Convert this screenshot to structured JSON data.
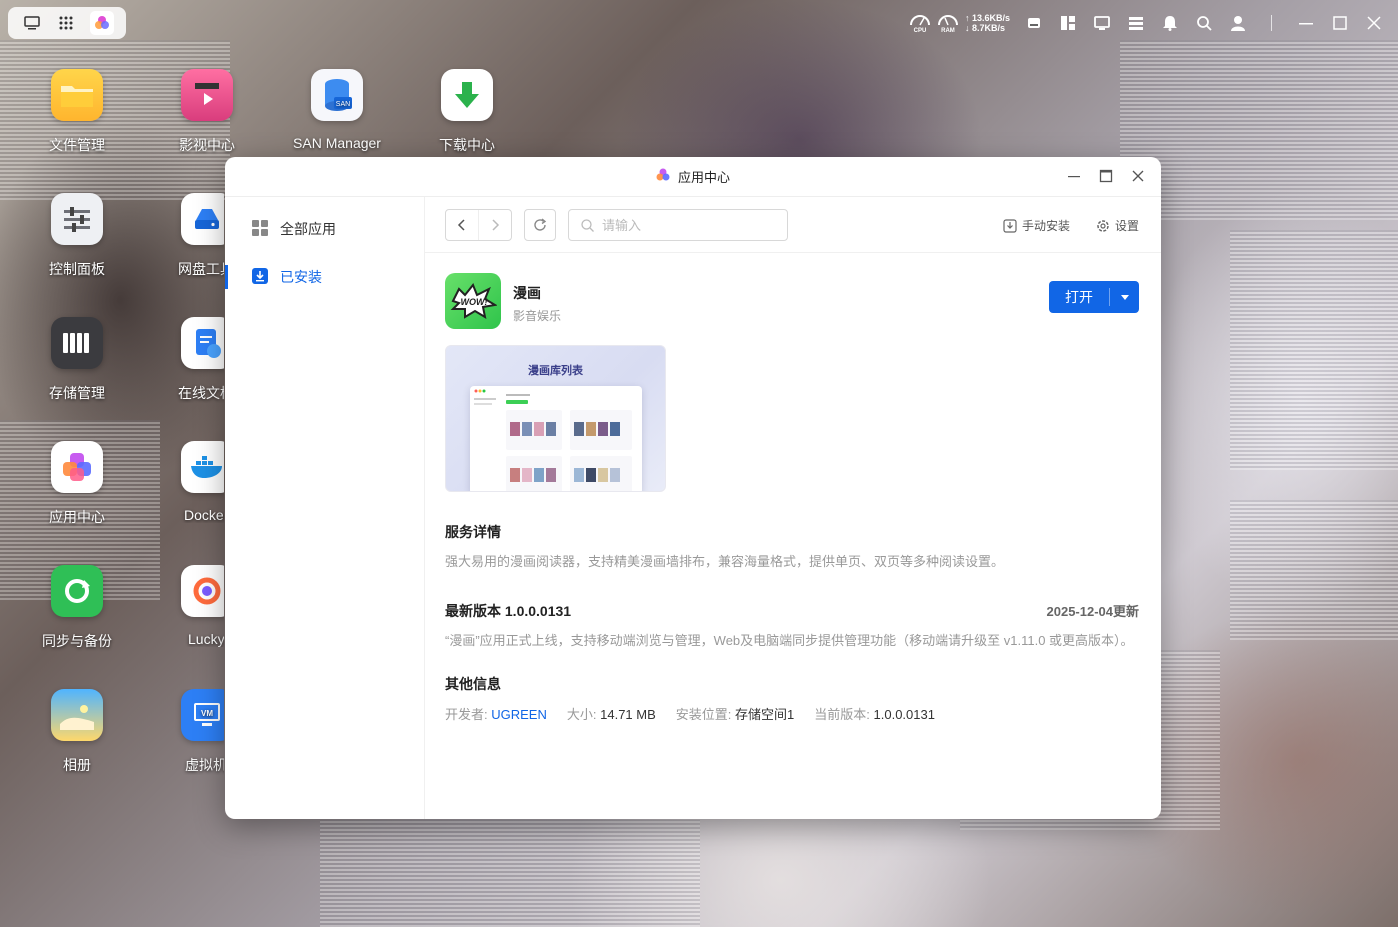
{
  "topbar": {
    "left_icons": [
      "desktop-icon",
      "app-grid-icon",
      "app-center-icon"
    ],
    "cpu_label": "CPU",
    "ram_label": "RAM",
    "upload_speed": "13.6KB/s",
    "download_speed": "8.7KB/s",
    "right_icons": [
      "drive-icon",
      "layout-icon",
      "monitor-icon",
      "server-icon",
      "bell-icon",
      "search-icon",
      "user-icon",
      "minimize-icon",
      "maximize-icon",
      "close-icon"
    ]
  },
  "desktop": {
    "icons": [
      {
        "label": "文件管理"
      },
      {
        "label": "影视中心"
      },
      {
        "label": "SAN Manager"
      },
      {
        "label": "下载中心"
      },
      {
        "label": "控制面板"
      },
      {
        "label": "网盘工具"
      },
      {
        "label": "存储管理"
      },
      {
        "label": "在线文档"
      },
      {
        "label": "应用中心"
      },
      {
        "label": "Docker"
      },
      {
        "label": "同步与备份"
      },
      {
        "label": "Lucky"
      },
      {
        "label": "相册"
      },
      {
        "label": "虚拟机"
      }
    ]
  },
  "window": {
    "title": "应用中心",
    "sidebar": [
      {
        "label": "全部应用"
      },
      {
        "label": "已安装"
      }
    ],
    "toolbar": {
      "search_placeholder": "请输入",
      "manual_install": "手动安装",
      "settings": "设置"
    },
    "app": {
      "name": "漫画",
      "category": "影音娱乐",
      "logo_text": "WOW!",
      "open_label": "打开",
      "screenshot_title": "漫画库列表",
      "service_title": "服务详情",
      "service_desc": "强大易用的漫画阅读器，支持精美漫画墙排布，兼容海量格式，提供单页、双页等多种阅读设置。",
      "version_title": "最新版本 1.0.0.0131",
      "version_date": "2025-12-04更新",
      "version_desc": "“漫画”应用正式上线，支持移动端浏览与管理，Web及电脑端同步提供管理功能（移动端请升级至 v1.11.0 或更高版本）。",
      "other_title": "其他信息",
      "developer_key": "开发者:",
      "developer_val": "UGREEN",
      "size_key": "大小:",
      "size_val": "14.71 MB",
      "location_key": "安装位置:",
      "location_val": "存储空间1",
      "current_key": "当前版本:",
      "current_val": "1.0.0.0131"
    }
  },
  "colors": {
    "accent": "#1166e6",
    "app_green": "#3ccf55"
  }
}
